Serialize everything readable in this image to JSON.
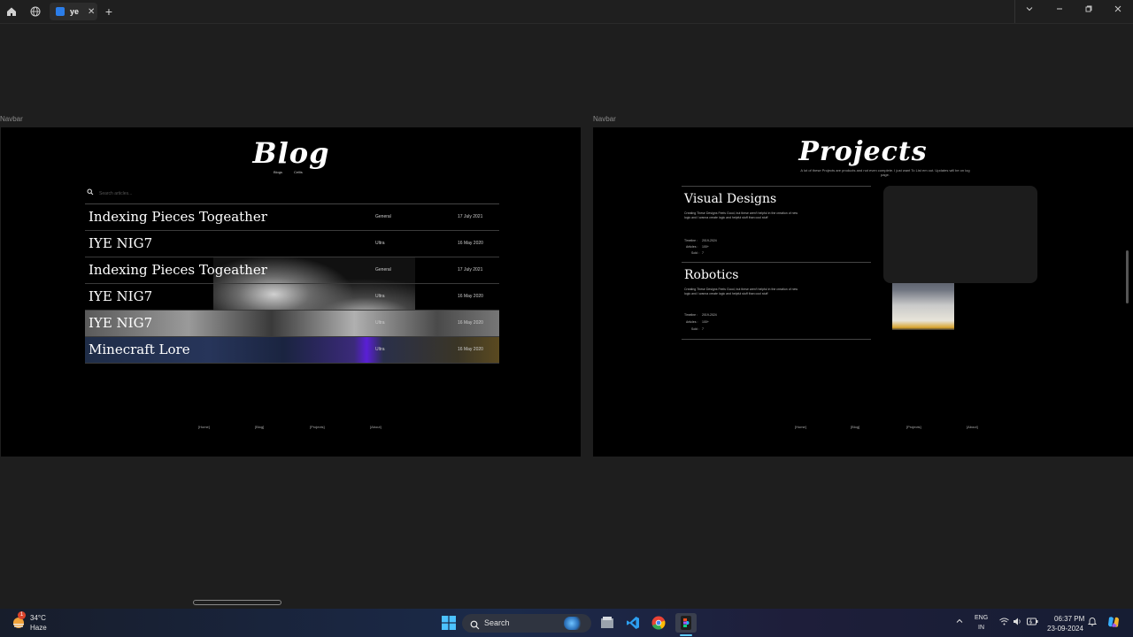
{
  "browser": {
    "tab_label": "ye",
    "tab_close": "✕",
    "new_tab": "+"
  },
  "canvas": {
    "left_frame_label": "Navbar",
    "right_frame_label": "Navbar"
  },
  "blog": {
    "title": "Blog",
    "nav": [
      "Blogs",
      "Cellis"
    ],
    "search_placeholder": "Search articles...",
    "articles": [
      {
        "title": "Indexing Pieces Togeather",
        "category": "General",
        "date": "17 July 2021"
      },
      {
        "title": "IYE NIG7",
        "category": "Ultra",
        "date": "16 May 2020"
      },
      {
        "title": "Indexing Pieces Togeather",
        "category": "General",
        "date": "17 July 2021"
      },
      {
        "title": "IYE NIG7",
        "category": "Ultra",
        "date": "16 May 2020"
      },
      {
        "title": "IYE NIG7",
        "category": "Ultra",
        "date": "16 May 2020"
      },
      {
        "title": "Minecraft Lore",
        "category": "Ultra",
        "date": "16 May 2020"
      }
    ],
    "footer": [
      "[Home]",
      "[Blog]",
      "[Projects]",
      "[About]"
    ]
  },
  "projects": {
    "title": "Projects",
    "subtitle": "A lot of these Projects are products and not even complete. I just want To List em out. Updates will be on log page.",
    "cards": [
      {
        "title": "Visual Designs",
        "description": "Creating These Designs Feels Good, but these aren't helpful in the creation of new logic and I wanna create logic and helpful stuff than cool stuff",
        "timeline_label": "Timeline :",
        "timeline": "2019-2024",
        "articles_label": "Articles :",
        "articles": "100+",
        "sold_label": "Sold :",
        "sold": "7"
      },
      {
        "title": "Robotics",
        "description": "Creating These Designs Feels Good, but these aren't helpful in the creation of new logic and I wanna create logic and helpful stuff than cool stuff",
        "timeline_label": "Timeline :",
        "timeline": "2019-2024",
        "articles_label": "Articles :",
        "articles": "100+",
        "sold_label": "Sold :",
        "sold": "7"
      }
    ],
    "footer": [
      "[Home]",
      "[Blog]",
      "[Projects]",
      "[About]"
    ]
  },
  "taskbar": {
    "weather_temp": "34°C",
    "weather_desc": "Haze",
    "weather_badge": "1",
    "search_label": "Search",
    "lang_line1": "ENG",
    "lang_line2": "IN",
    "time": "06:37 PM",
    "date": "23-09-2024"
  }
}
